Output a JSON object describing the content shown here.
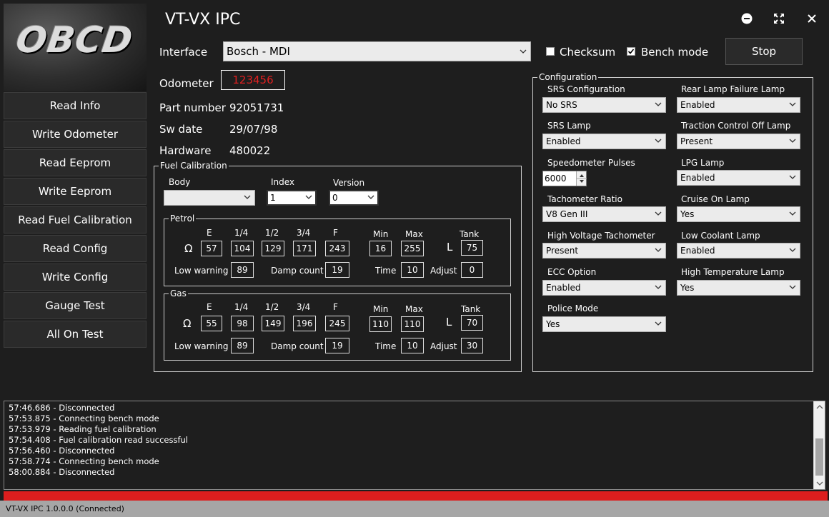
{
  "app": {
    "title": "VT-VX IPC",
    "logo_text": "OBCD"
  },
  "sidebar": {
    "items": [
      {
        "label": "Read Info"
      },
      {
        "label": "Write Odometer"
      },
      {
        "label": "Read Eeprom"
      },
      {
        "label": "Write Eeprom"
      },
      {
        "label": "Read Fuel Calibration"
      },
      {
        "label": "Read Config"
      },
      {
        "label": "Write Config"
      },
      {
        "label": "Gauge Test"
      },
      {
        "label": "All On Test"
      }
    ]
  },
  "top": {
    "interface_label": "Interface",
    "interface_value": "Bosch - MDI",
    "checksum_label": "Checksum",
    "checksum_checked": false,
    "bench_label": "Bench mode",
    "bench_checked": true,
    "stop_label": "Stop"
  },
  "info": {
    "odometer_label": "Odometer",
    "odometer_value": "123456",
    "part_label": "Part number",
    "part_value": "92051731",
    "sw_label": "Sw date",
    "sw_value": "29/07/98",
    "hw_label": "Hardware",
    "hw_value": "480022"
  },
  "fuel": {
    "title": "Fuel Calibration",
    "body_label": "Body",
    "body_value": "",
    "index_label": "Index",
    "index_value": "1",
    "version_label": "Version",
    "version_value": "0",
    "headers": {
      "e": "E",
      "q1": "1/4",
      "q2": "1/2",
      "q3": "3/4",
      "f": "F",
      "min": "Min",
      "max": "Max",
      "tank": "Tank"
    },
    "ohm": "Ω",
    "litre": "L",
    "low_warning_label": "Low warning",
    "damp_label": "Damp count",
    "time_label": "Time",
    "adjust_label": "Adjust",
    "petrol": {
      "title": "Petrol",
      "e": "57",
      "q1": "104",
      "q2": "129",
      "q3": "171",
      "f": "243",
      "min": "16",
      "max": "255",
      "tank": "75",
      "low_warning": "89",
      "damp": "19",
      "time": "10",
      "adjust": "0"
    },
    "gas": {
      "title": "Gas",
      "e": "55",
      "q1": "98",
      "q2": "149",
      "q3": "196",
      "f": "245",
      "min": "110",
      "max": "110",
      "tank": "70",
      "low_warning": "89",
      "damp": "19",
      "time": "10",
      "adjust": "30"
    }
  },
  "config": {
    "title": "Configuration",
    "left": [
      {
        "label": "SRS Configuration",
        "value": "No SRS"
      },
      {
        "label": "SRS Lamp",
        "value": "Enabled"
      },
      {
        "label": "Speedometer Pulses",
        "value": "6000"
      },
      {
        "label": "Tachometer Ratio",
        "value": "V8 Gen III"
      },
      {
        "label": "High Voltage Tachometer",
        "value": "Present"
      },
      {
        "label": "ECC Option",
        "value": "Enabled"
      },
      {
        "label": "Police Mode",
        "value": "Yes"
      }
    ],
    "right": [
      {
        "label": "Rear Lamp Failure Lamp",
        "value": "Enabled"
      },
      {
        "label": "Traction Control Off Lamp",
        "value": "Present"
      },
      {
        "label": "LPG Lamp",
        "value": "Enabled"
      },
      {
        "label": "Cruise On Lamp",
        "value": "Yes"
      },
      {
        "label": "Low Coolant Lamp",
        "value": "Enabled"
      },
      {
        "label": "High Temperature Lamp",
        "value": "Yes"
      }
    ]
  },
  "log": {
    "lines": [
      "57:46.686 - Disconnected",
      "57:53.875 - Connecting bench mode",
      "57:53.979 - Reading fuel calibration",
      "57:54.408 - Fuel calibration read successful",
      "57:56.460 - Disconnected",
      "57:58.774 - Connecting bench mode",
      "58:00.884 - Disconnected"
    ]
  },
  "status": {
    "text": "VT-VX IPC 1.0.0.0 (Connected)"
  },
  "colors": {
    "status_red": "#dc1e1e",
    "odometer_text": "#e02020"
  }
}
